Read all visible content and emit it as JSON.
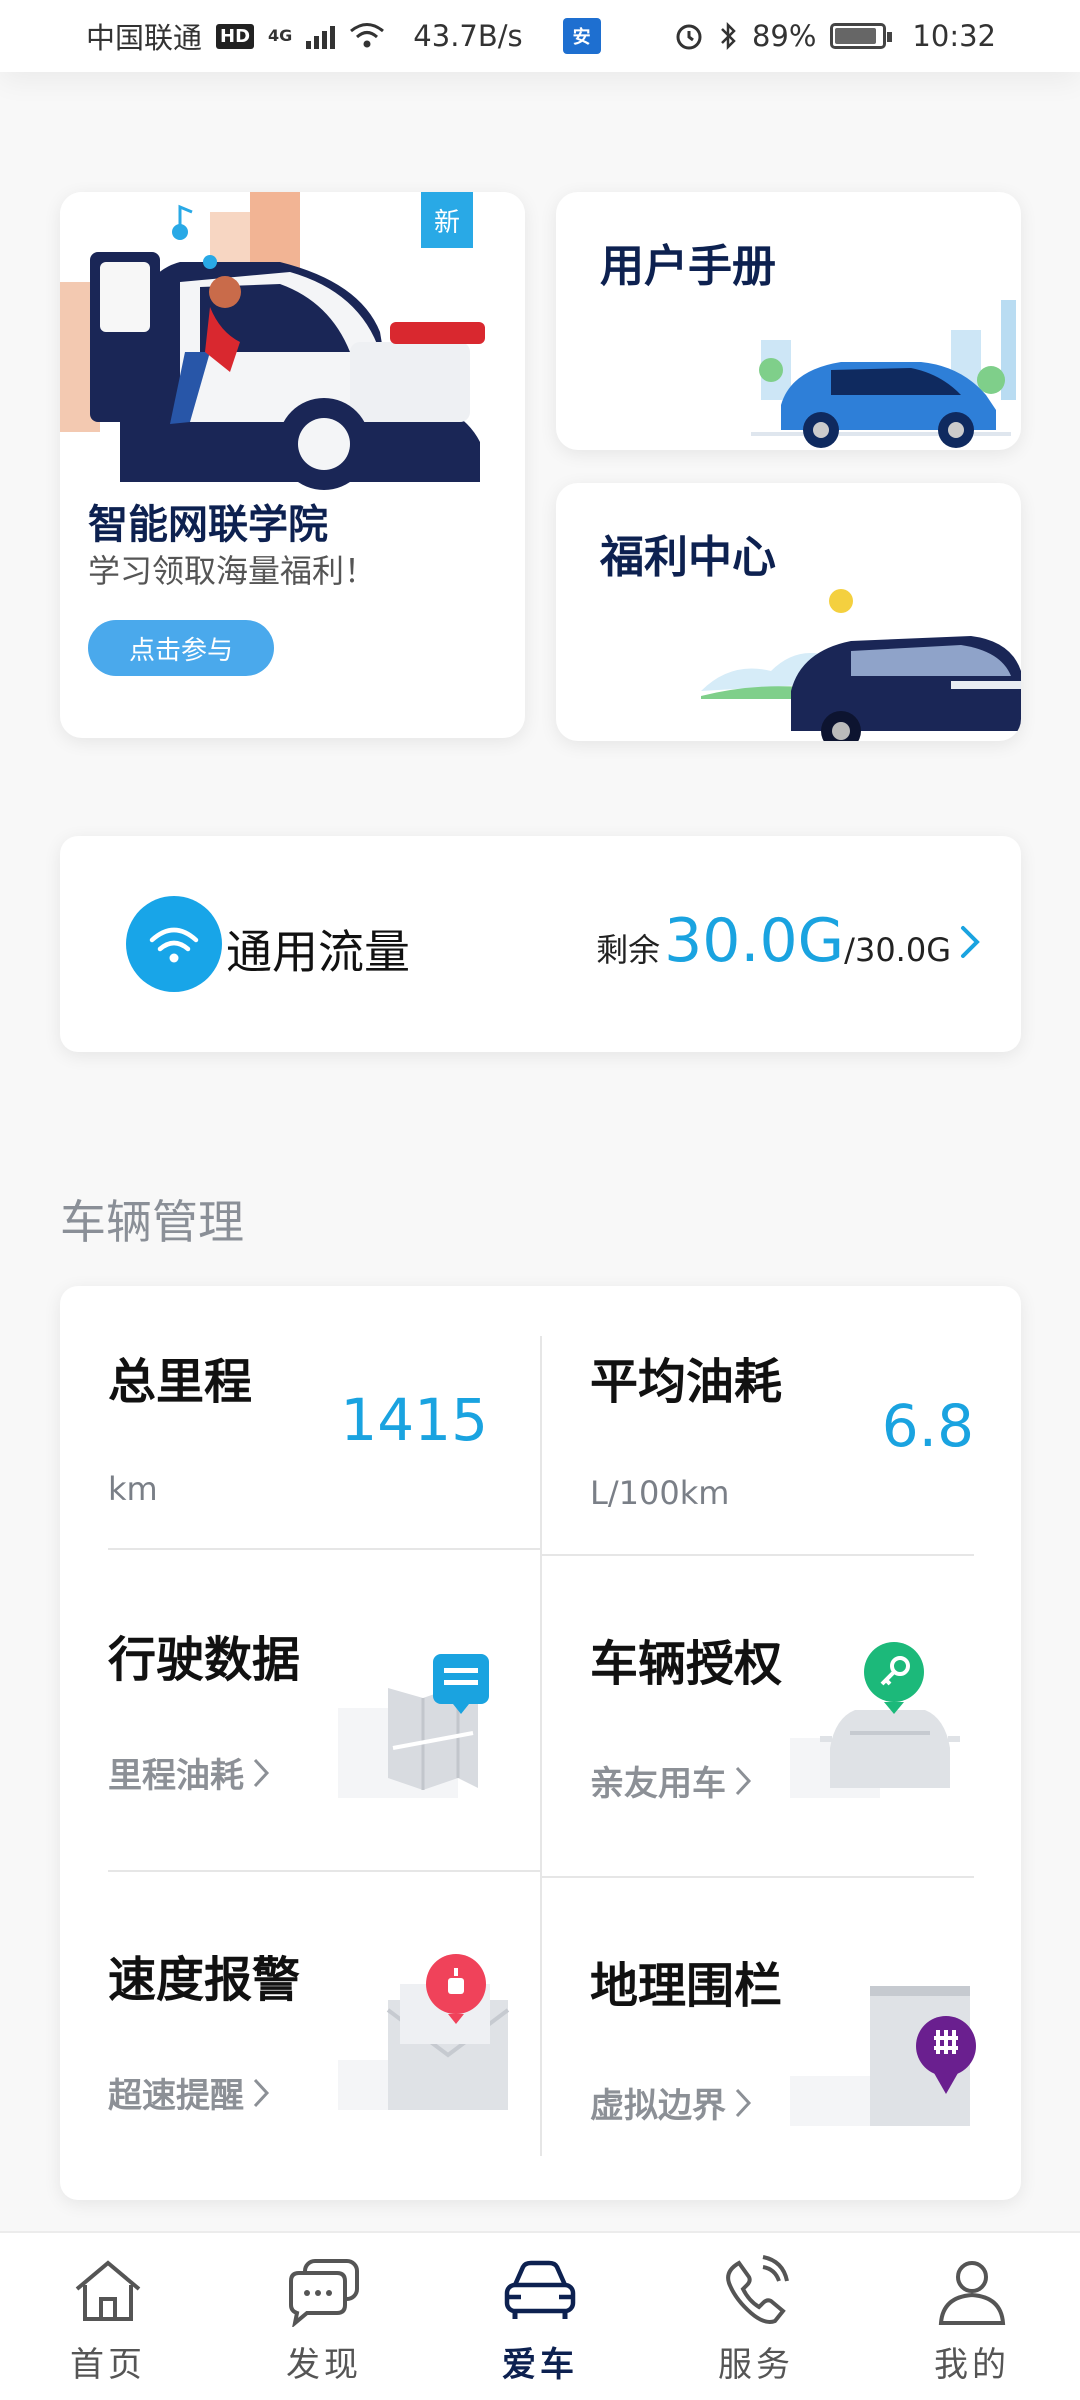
{
  "status_bar": {
    "carrier": "中国联通",
    "hd": "HD",
    "network": "4G",
    "speed": "43.7B/s",
    "battery": "89%",
    "time": "10:32"
  },
  "cards": {
    "academy": {
      "badge": "新",
      "title": "智能网联学院",
      "subtitle": "学习领取海量福利！",
      "button": "点击参与"
    },
    "manual": {
      "title": "用户手册"
    },
    "welfare": {
      "title": "福利中心"
    }
  },
  "data_plan": {
    "label": "通用流量",
    "remaining_label": "剩余",
    "remaining_value": "30.0G",
    "total": "/30.0G"
  },
  "vehicle_management": {
    "section_title": "车辆管理",
    "mileage": {
      "title": "总里程",
      "value": "1415",
      "unit": "km"
    },
    "fuel": {
      "title": "平均油耗",
      "value": "6.8",
      "unit": "L/100km"
    },
    "driving_data": {
      "title": "行驶数据",
      "link": "里程油耗"
    },
    "authorization": {
      "title": "车辆授权",
      "link": "亲友用车"
    },
    "speed_alert": {
      "title": "速度报警",
      "link": "超速提醒"
    },
    "geofence": {
      "title": "地理围栏",
      "link": "虚拟边界"
    }
  },
  "bottom_nav": [
    {
      "label": "首页",
      "icon": "home-icon"
    },
    {
      "label": "发现",
      "icon": "chat-icon"
    },
    {
      "label": "爱车",
      "icon": "car-icon",
      "active": true
    },
    {
      "label": "服务",
      "icon": "phone-icon"
    },
    {
      "label": "我的",
      "icon": "user-icon"
    }
  ],
  "colors": {
    "accent": "#1aa3e0",
    "navy": "#0d2150",
    "button": "#4aa9ec"
  }
}
